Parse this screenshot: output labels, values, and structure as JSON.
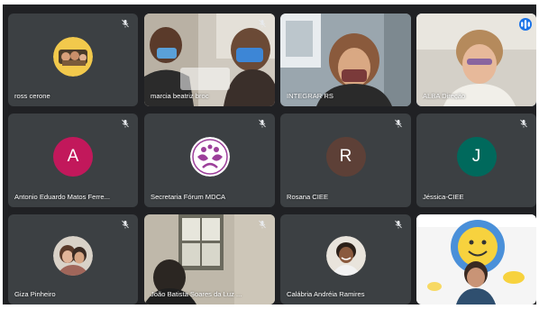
{
  "meeting": {
    "participants": [
      {
        "name": "ross cerone",
        "tile": "avatar-photo",
        "muted": true
      },
      {
        "name": "marcia beatriz broc",
        "tile": "video",
        "muted": true
      },
      {
        "name": "INTEGRAR RS",
        "tile": "video",
        "muted": false
      },
      {
        "name": "ALBA Direção",
        "tile": "video",
        "muted": false,
        "speaking": true
      },
      {
        "name": "Antonio Eduardo Matos Ferre...",
        "tile": "avatar-letter",
        "initial": "A",
        "avatar_color": "#c2185b",
        "muted": true
      },
      {
        "name": "Secretaria Fórum MDCA",
        "tile": "avatar-logo",
        "muted": true
      },
      {
        "name": "Rosana CIEE",
        "tile": "avatar-letter",
        "initial": "R",
        "avatar_color": "#5d4037",
        "muted": true
      },
      {
        "name": "Jéssica-CIEE",
        "tile": "avatar-letter",
        "initial": "J",
        "avatar_color": "#00695c",
        "muted": true
      },
      {
        "name": "Giza Pinheiro",
        "tile": "avatar-photo",
        "muted": true
      },
      {
        "name": "João Batista Soares da Luz ...",
        "tile": "video",
        "muted": true
      },
      {
        "name": "Calábria Andréia Ramires",
        "tile": "avatar-photo",
        "muted": true
      },
      {
        "name": "",
        "tile": "video",
        "muted": false
      }
    ]
  },
  "icons": {
    "mic_off": "mic-off-icon",
    "speaking": "audio-level-icon"
  },
  "colors": {
    "background": "#202124",
    "tile": "#3c4043",
    "speaking_border": "#8ab4f8",
    "speaking_badge": "#1a73e8"
  }
}
